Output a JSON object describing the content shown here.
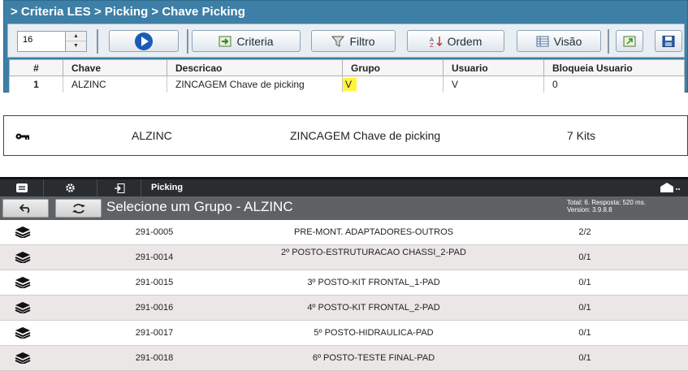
{
  "panel1": {
    "breadcrumb": "> Criteria LES > Picking > Chave Picking",
    "spinner_value": "16",
    "toolbar": {
      "criteria": "Criteria",
      "filtro": "Filtro",
      "ordem": "Ordem",
      "visao": "Visão"
    },
    "columns": [
      "#",
      "Chave",
      "Descricao",
      "Grupo",
      "Usuario",
      "Bloqueia Usuario"
    ],
    "rows": [
      {
        "num": "1",
        "chave": "ALZINC",
        "descricao": "ZINCAGEM Chave de picking",
        "grupo": "V",
        "usuario": "V",
        "bloqueia": "0"
      }
    ],
    "highlight_color": "#fff33b"
  },
  "panel2": {
    "icon": "key-icon",
    "chave": "ALZINC",
    "descricao": "ZINCAGEM Chave de picking",
    "kits": "7 Kits"
  },
  "panel3": {
    "breadcrumb": "Picking",
    "title": "Selecione um Grupo - ALZINC",
    "status_total": "Total: 6. Resposta: 520 ms.",
    "status_version": "Version: 3.9.8.8",
    "rows": [
      {
        "code": "291-0005",
        "desc": "PRE-MONT. ADAPTADORES-OUTROS",
        "qty": "2/2"
      },
      {
        "code": "291-0014",
        "desc": "2º POSTO-ESTRUTURACAO CHASSI_2-PAD",
        "qty": "0/1"
      },
      {
        "code": "291-0015",
        "desc": "3º POSTO-KIT FRONTAL_1-PAD",
        "qty": "0/1"
      },
      {
        "code": "291-0016",
        "desc": "4º POSTO-KIT FRONTAL_2-PAD",
        "qty": "0/1"
      },
      {
        "code": "291-0017",
        "desc": "5º POSTO-HIDRAULICA-PAD",
        "qty": "0/1"
      },
      {
        "code": "291-0018",
        "desc": "6º POSTO-TESTE FINAL-PAD",
        "qty": "0/1"
      }
    ]
  }
}
